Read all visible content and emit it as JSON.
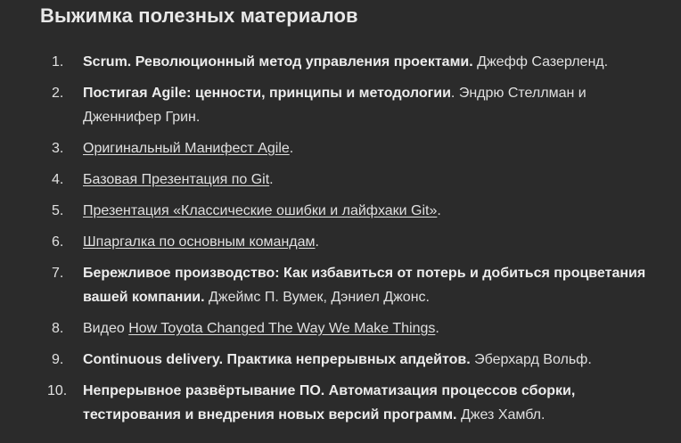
{
  "heading": "Выжимка полезных материалов",
  "items": [
    {
      "num": "1.",
      "bold": "Scrum. Революционный метод управления проектами.",
      "rest": " Джефф Сазерленд."
    },
    {
      "num": "2.",
      "bold": "Постигая Agile: ценности, принципы и методологии",
      "rest": ". Эндрю Стеллман и Дженнифер Грин."
    },
    {
      "num": "3.",
      "link": "Оригинальный Манифест Agile",
      "rest": "."
    },
    {
      "num": "4.",
      "link": "Базовая Презентация по Git",
      "rest": "."
    },
    {
      "num": "5.",
      "link": "Презентация «Классические ошибки и лайфхаки Git»",
      "rest": "."
    },
    {
      "num": "6.",
      "link": "Шпаргалка по основным командам",
      "rest": "."
    },
    {
      "num": "7.",
      "bold": "Бережливое производство: Как избавиться от потерь и добиться процветания вашей компании.",
      "rest": " Джеймс П. Вумек, Дэниел Джонс."
    },
    {
      "num": "8.",
      "prefix": "Видео ",
      "link": "How Toyota Changed The Way We Make Things",
      "rest": "."
    },
    {
      "num": "9.",
      "bold": "Continuous delivery. Практика непрерывных апдейтов.",
      "rest": " Эберхард Вольф."
    },
    {
      "num": "10.",
      "bold": "Непрерывное развёртывание ПО. Автоматизация процессов сборки, тестирования и внедрения новых версий программ.",
      "rest": " Джез Хамбл."
    }
  ]
}
